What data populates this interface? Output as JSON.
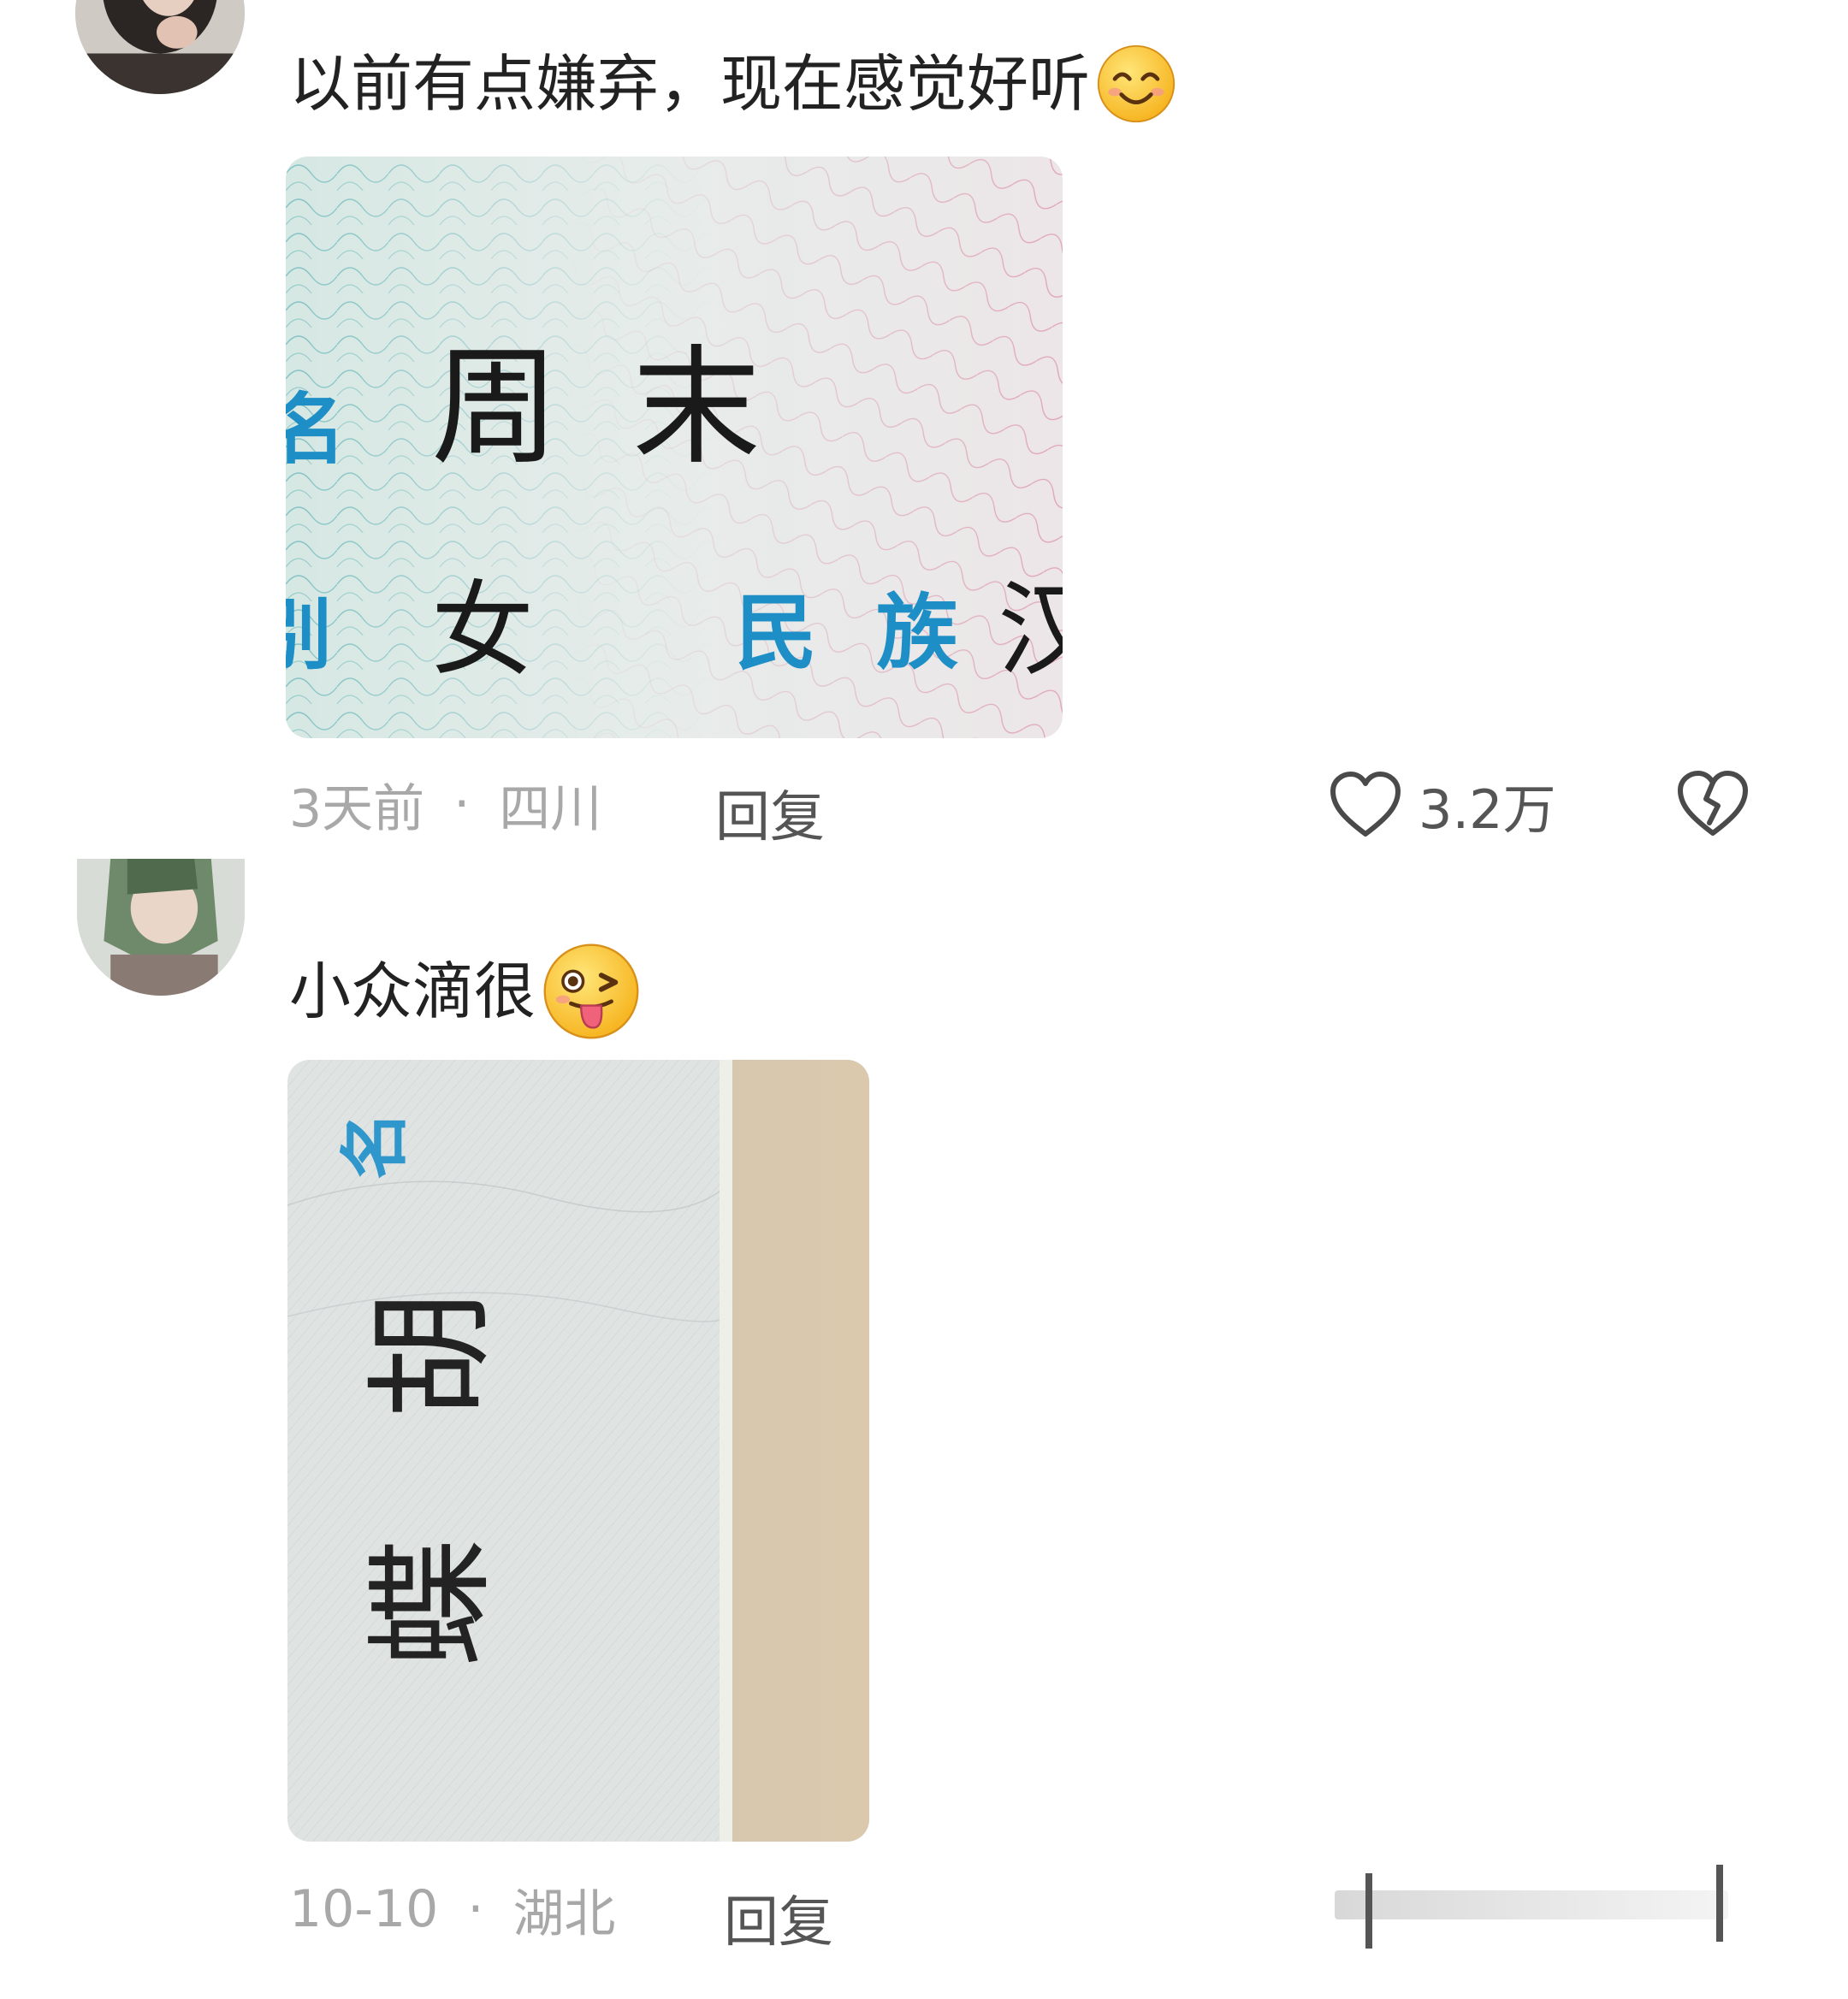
{
  "comments": [
    {
      "text": "以前有点嫌弃，现在感觉好听",
      "emoji": "smiling-face-emoji",
      "photo": {
        "name_chars": [
          "周",
          "末"
        ],
        "sex_value": "女",
        "ethnicity_label_chars": [
          "民",
          "族"
        ],
        "ethnicity_value": "汉",
        "edge_fragments": [
          "名",
          "别"
        ]
      },
      "time": "3天前",
      "separator": "·",
      "location": "四川",
      "reply_label": "回复",
      "like_count": "3.2万",
      "icons": [
        "heart-outline-icon",
        "broken-heart-icon"
      ]
    },
    {
      "text": "小众滴很",
      "emoji": "winking-tongue-emoji",
      "photo": {
        "label_char": "名",
        "name_chars": [
          "胡",
          "蝶"
        ]
      },
      "time": "10-10",
      "separator": "·",
      "location": "湖北",
      "reply_label": "回复"
    }
  ],
  "colors": {
    "text_primary": "#222222",
    "text_meta": "#a8a8a8",
    "text_action": "#555555",
    "id_label_blue": "#1e8fc6",
    "background": "#ffffff"
  }
}
